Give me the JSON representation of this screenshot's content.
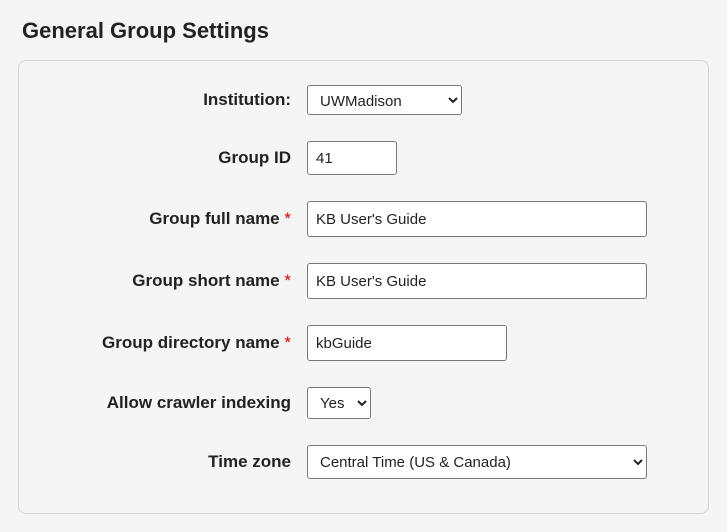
{
  "title": "General Group Settings",
  "fields": {
    "institution": {
      "label": "Institution:",
      "value": "UWMadison",
      "required": false
    },
    "group_id": {
      "label": "Group ID",
      "value": "41",
      "required": false
    },
    "group_full_name": {
      "label": "Group full name",
      "value": "KB User's Guide",
      "required": true
    },
    "group_short_name": {
      "label": "Group short name",
      "value": "KB User's Guide",
      "required": true
    },
    "group_directory_name": {
      "label": "Group directory name",
      "value": "kbGuide",
      "required": true
    },
    "allow_crawler": {
      "label": "Allow crawler indexing",
      "value": "Yes",
      "required": false
    },
    "time_zone": {
      "label": "Time zone",
      "value": "Central Time (US & Canada)",
      "required": false
    }
  },
  "required_marker": "*"
}
